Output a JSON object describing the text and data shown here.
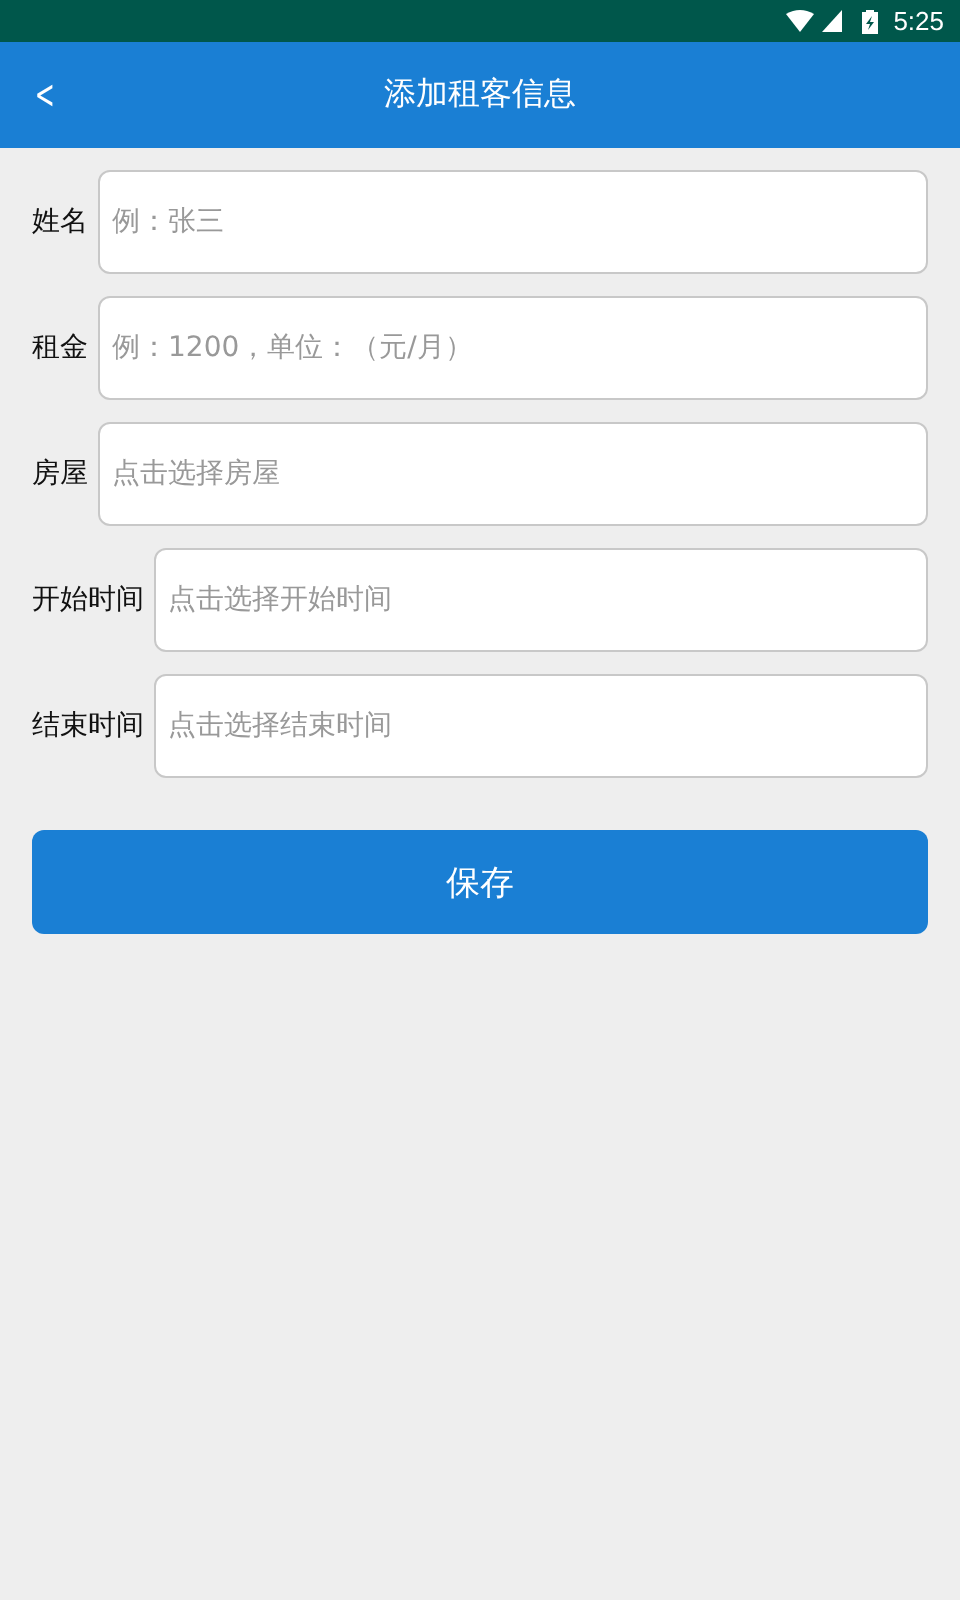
{
  "status_bar": {
    "time": "5:25"
  },
  "header": {
    "back": "<",
    "title": "添加租客信息"
  },
  "fields": [
    {
      "label": "姓名",
      "placeholder": "例：张三"
    },
    {
      "label": "租金",
      "placeholder": "例：1200，单位：（元/月）"
    },
    {
      "label": "房屋",
      "placeholder": "点击选择房屋"
    },
    {
      "label": "开始时间",
      "placeholder": "点击选择开始时间"
    },
    {
      "label": "结束时间",
      "placeholder": "点击选择结束时间"
    }
  ],
  "save_button": "保存"
}
